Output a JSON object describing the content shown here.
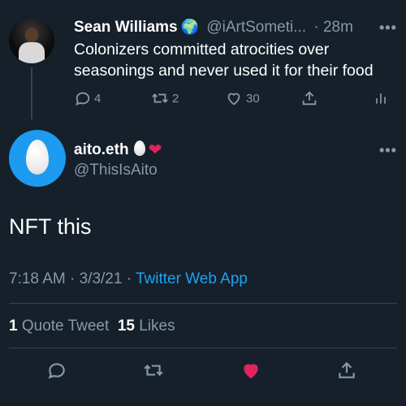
{
  "parent_tweet": {
    "name": "Sean Williams",
    "badge_icon": "globe-emoji",
    "handle": "@iArtSometi...",
    "time": "· 28m",
    "more": "•••",
    "text": "Colonizers committed atrocities over seasonings and never used it for their food",
    "actions": {
      "reply_count": "4",
      "retweet_count": "2",
      "like_count": "30"
    }
  },
  "main_tweet": {
    "name": "aito.eth",
    "name_emojis": [
      "egg-emoji",
      "red-heart-emoji"
    ],
    "handle": "@ThisIsAito",
    "more": "•••",
    "text": "NFT this",
    "timestamp": "7:18 AM · 3/3/21 · ",
    "source": "Twitter Web App",
    "quote_count": "1",
    "quote_label": "Quote Tweet",
    "like_count": "15",
    "like_label": "Likes",
    "liked": true
  },
  "colors": {
    "background": "#15202b",
    "secondary_text": "#8899a6",
    "link": "#1da1f2",
    "like": "#e0245e",
    "divider": "#38444d"
  }
}
